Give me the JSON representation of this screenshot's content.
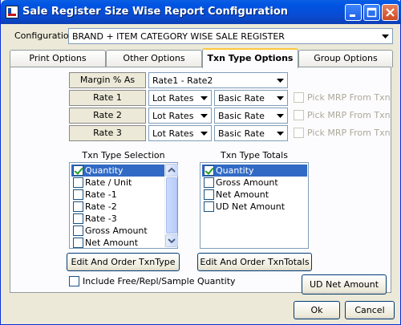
{
  "window": {
    "title": "Sale Register Size Wise Report Configuration"
  },
  "configuration": {
    "label": "Configuration",
    "value": "BRAND + ITEM CATEGORY WISE SALE REGISTER"
  },
  "tabs": [
    {
      "label": "Print Options"
    },
    {
      "label": "Other Options"
    },
    {
      "label": "Txn Type Options"
    },
    {
      "label": "Group Options"
    }
  ],
  "margin": {
    "label": "Margin % As",
    "value": "Rate1 - Rate2"
  },
  "rates": [
    {
      "label": "Rate 1",
      "rate_type": "Lot Rates",
      "rate_basis": "Basic Rate",
      "pick_label": "Pick MRP From Txn"
    },
    {
      "label": "Rate 2",
      "rate_type": "Lot Rates",
      "rate_basis": "Basic Rate",
      "pick_label": "Pick MRP From Txn"
    },
    {
      "label": "Rate 3",
      "rate_type": "Lot Rates",
      "rate_basis": "Basic Rate",
      "pick_label": "Pick MRP From Txn"
    }
  ],
  "txn_selection": {
    "title": "Txn Type Selection",
    "items": [
      {
        "label": "Quantity",
        "checked": true
      },
      {
        "label": "Rate / Unit",
        "checked": false
      },
      {
        "label": "Rate -1",
        "checked": false
      },
      {
        "label": "Rate -2",
        "checked": false
      },
      {
        "label": "Rate -3",
        "checked": false
      },
      {
        "label": "Gross Amount",
        "checked": false
      },
      {
        "label": "Net Amount",
        "checked": false
      }
    ],
    "button": "Edit And Order TxnType"
  },
  "txn_totals": {
    "title": "Txn Type Totals",
    "items": [
      {
        "label": "Quantity",
        "checked": true
      },
      {
        "label": "Gross Amount",
        "checked": false
      },
      {
        "label": "Net Amount",
        "checked": false
      },
      {
        "label": "UD Net Amount",
        "checked": false
      }
    ],
    "button": "Edit And Order TxnTotals"
  },
  "include_free": {
    "label": "Include Free/Repl/Sample Quantity",
    "checked": false
  },
  "buttons": {
    "ud_net_amount": "UD Net Amount",
    "ok": "Ok",
    "cancel": "Cancel"
  },
  "colors": {
    "title_bar": "#0054e3",
    "selection": "#316ac5",
    "active_tab_accent": "#ffc83c",
    "dialog_bg": "#ece9d8"
  }
}
